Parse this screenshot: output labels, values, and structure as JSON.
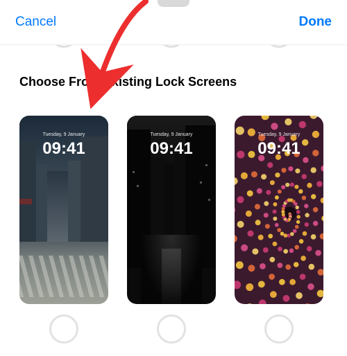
{
  "header": {
    "cancel_label": "Cancel",
    "done_label": "Done"
  },
  "section": {
    "title": "Choose From Existing Lock Screens"
  },
  "lockscreens": [
    {
      "date": "Tuesday, 9 January",
      "time": "09:41"
    },
    {
      "date": "Tuesday, 9 January",
      "time": "09:41"
    },
    {
      "date": "Tuesday, 9 January",
      "time": "09:41"
    }
  ],
  "colors": {
    "ios_blue": "#007aff",
    "arrow_red": "#ed2e2e"
  }
}
